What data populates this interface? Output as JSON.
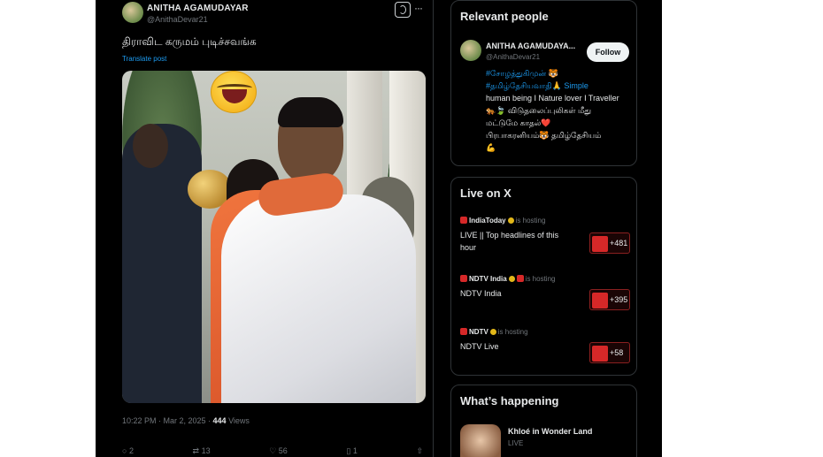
{
  "tweet": {
    "author_name": "ANITHA AGAMUDAYAR",
    "author_handle": "@AnithaDevar21",
    "text": "திராவிட கருமம் புடிச்சவங்க",
    "translate_label": "Translate post",
    "time": "10:22 PM · Mar 2, 2025 · ",
    "views_count": "444",
    "views_label": " Views",
    "actions": [
      {
        "icon": "reply-icon",
        "count": "2"
      },
      {
        "icon": "repost-icon",
        "count": "13"
      },
      {
        "icon": "like-icon",
        "count": "56"
      },
      {
        "icon": "bookmark-icon",
        "count": "1"
      },
      {
        "icon": "share-icon",
        "count": ""
      }
    ]
  },
  "relevant_people": {
    "title": "Relevant people",
    "name": "ANITHA AGAMUDAYA...",
    "handle": "@AnithaDevar21",
    "follow_label": "Follow",
    "bio": [
      {
        "text": "#சோழத்துகிமுன் 🐯",
        "link": true
      },
      {
        "text": "#தமிழ்தேசியவாதி🙏 Simple",
        "link": false
      },
      {
        "text": "human being I Nature lover I Traveller",
        "link": false
      },
      {
        "text": "🐅🍃 விடுதலைப்புலிகள் மீது",
        "link": false
      },
      {
        "text": "மட்டுமே காதல்❤️",
        "link": false
      },
      {
        "text": "பிரபாகரனியம்🐯 தமிழ்தேசியம்",
        "link": false
      },
      {
        "text": "💪",
        "link": false
      }
    ]
  },
  "live_on_x": {
    "title": "Live on X",
    "items": [
      {
        "host": "IndiaToday",
        "hosting_label": "is hosting",
        "title": "LIVE || Top headlines of this hour",
        "count": "+481"
      },
      {
        "host": "NDTV India",
        "hosting_label": "is hosting",
        "title": "NDTV India",
        "count": "+395"
      },
      {
        "host": "NDTV",
        "hosting_label": "is hosting",
        "title": "NDTV Live",
        "count": "+58"
      }
    ]
  },
  "whats_happening": {
    "title": "What’s happening",
    "item_title": "Khloé in Wonder Land",
    "item_sub": "LIVE"
  },
  "colors": {
    "background": "#000000",
    "link": "#1d9bf0",
    "text": "#e7e9ea",
    "muted": "#71767b",
    "live_red": "#d62828"
  }
}
